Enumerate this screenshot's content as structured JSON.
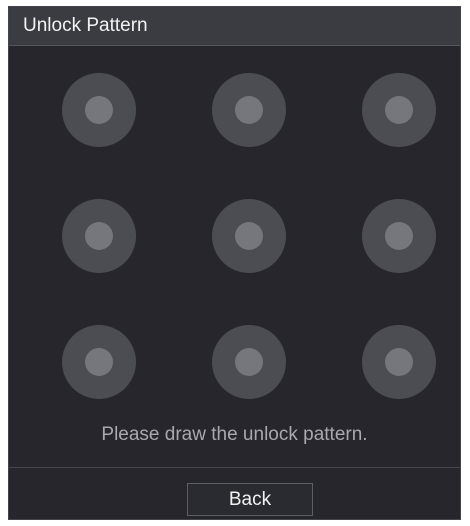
{
  "dialog": {
    "title": "Unlock Pattern",
    "hint": "Please draw the unlock pattern.",
    "back_label": "Back"
  },
  "pattern": {
    "rows": 3,
    "columns": 3,
    "dot_icon": "pattern-node-icon",
    "selected_nodes": []
  },
  "colors": {
    "background": "#26262c",
    "title_bar": "#3b3c42",
    "node_outer": "#4c4d53",
    "node_inner": "#76777d",
    "hint_text": "#a8a8ae"
  }
}
